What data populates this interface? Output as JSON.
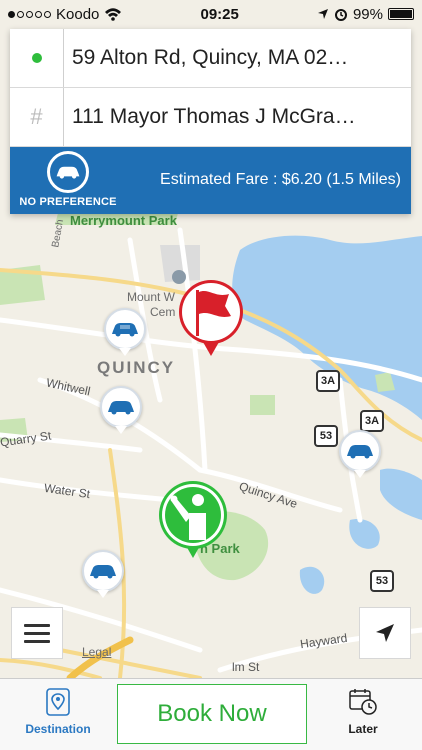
{
  "status_bar": {
    "carrier": "Koodo",
    "time": "09:25",
    "battery": "99%"
  },
  "trip": {
    "pickup_address": "59 Alton Rd, Quincy, MA 02…",
    "destination_address": "111 Mayor Thomas J McGra…",
    "preference_label": "NO PREFERENCE",
    "fare_text": "Estimated Fare : $6.20 (1.5 Miles)"
  },
  "map": {
    "labels": {
      "merrymount_park": "Merrymount Park",
      "mount_w": "Mount W",
      "cem": "Cem",
      "quincy": "QUINCY",
      "whitwell": "Whitwell",
      "quarry_st": "Quarry St",
      "water_st": "Water St",
      "quincy_ave": "Quincy Ave",
      "park": "n Park",
      "hayward": "Hayward",
      "legal": "Legal",
      "elm_st": "lm St",
      "beach": "Beach"
    },
    "shields": {
      "route_3a_left": "3A",
      "route_3a_right": "3A",
      "route_53_top": "53",
      "route_53_bottom": "53"
    }
  },
  "bottom_bar": {
    "destination_label": "Destination",
    "book_now_label": "Book Now",
    "later_label": "Later"
  },
  "colors": {
    "brand_blue": "#1f6fb4",
    "book_green": "#2ead3a",
    "water": "#a4cdf0",
    "park_green": "#c9e4b4"
  },
  "icons": {
    "signal": "signal-dots-icon",
    "wifi": "wifi-icon",
    "location": "location-arrow-icon",
    "alarm": "alarm-icon",
    "battery": "battery-icon",
    "taxi": "taxi-car-icon",
    "flag": "flag-icon",
    "passenger": "passenger-wave-icon",
    "menu": "menu-icon",
    "locate": "locate-me-icon",
    "destination": "destination-icon",
    "later": "calendar-clock-icon"
  }
}
